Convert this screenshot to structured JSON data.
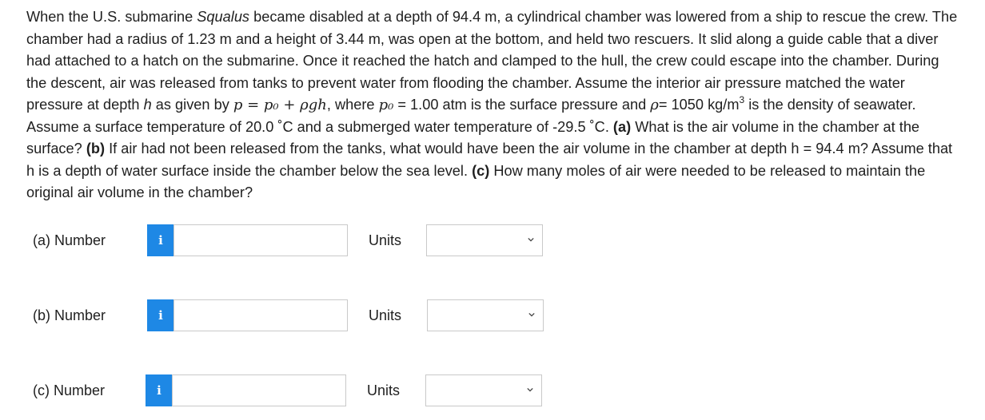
{
  "question": {
    "intro": "When the U.S. submarine ",
    "ship_name": "Squalus",
    "text1": " became disabled at a depth of 94.4 m, a cylindrical chamber was lowered from a ship to rescue the crew. The chamber had a radius of 1.23 m and a height of 3.44 m, was open at the bottom, and held two rescuers. It slid along a guide cable that a diver had attached to a hatch on the submarine. Once it reached the hatch and clamped to the hull, the crew could escape into the chamber. During the descent, air was released from tanks to prevent water from flooding the chamber. Assume the interior air pressure matched the water pressure at depth ",
    "h_var": "h",
    "text2": " as given by ",
    "formula": "p = p₀ + ρgh",
    "text3": ", where ",
    "p0_var": "p₀",
    "text4": " = 1.00 atm is the surface pressure and ",
    "rho_var": "ρ",
    "text5": "= 1050 kg/m",
    "cube": "3",
    "text6": " is the density of seawater. Assume a surface temperature of 20.0 ˚C and a submerged water temperature of -29.5 ˚C. ",
    "qa_label": "(a)",
    "qa_text": " What is the air volume in the chamber at the surface? ",
    "qb_label": "(b)",
    "qb_text": " If air had not been released from the tanks, what would have been the air volume in the chamber at depth h = 94.4 m? Assume that h is a depth of water surface inside the chamber below the sea level. ",
    "qc_label": "(c)",
    "qc_text": " How many moles of air were needed to be released to maintain the original air volume in the chamber?"
  },
  "answers": [
    {
      "label": "(a)   Number",
      "info": "i",
      "value": "",
      "units_label": "Units",
      "units_value": ""
    },
    {
      "label": "(b)   Number",
      "info": "i",
      "value": "",
      "units_label": "Units",
      "units_value": ""
    },
    {
      "label": "(c)   Number",
      "info": "i",
      "value": "",
      "units_label": "Units",
      "units_value": ""
    }
  ],
  "icons": {
    "info": "info-icon",
    "dropdown": "chevron-down-icon"
  },
  "colors": {
    "info_button": "#1e88e5",
    "border": "#c9c9c9",
    "text": "#1f1f1f"
  }
}
